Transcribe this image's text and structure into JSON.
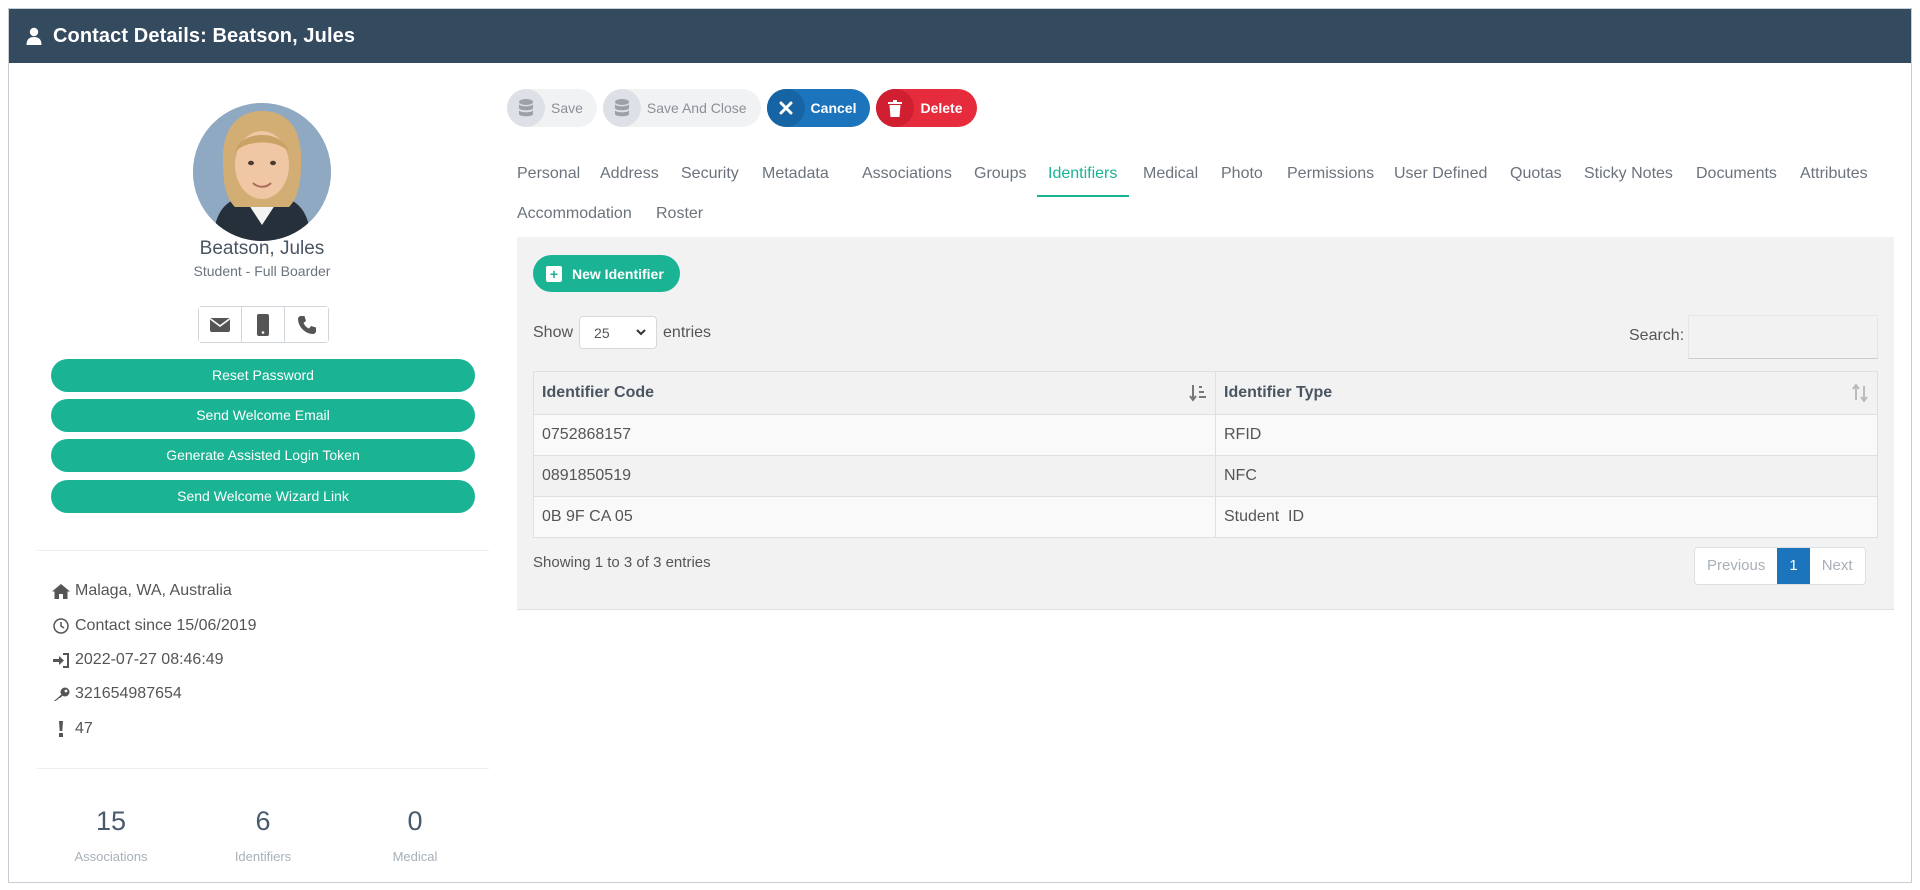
{
  "window": {
    "title": "Contact Details: Beatson, Jules"
  },
  "profile": {
    "name": "Beatson, Jules",
    "role": "Student - Full Boarder",
    "contact_icons": [
      "envelope-icon",
      "mobile-icon",
      "phone-icon"
    ],
    "actions": [
      "Reset Password",
      "Send Welcome Email",
      "Generate Assisted Login Token",
      "Send Welcome Wizard Link"
    ],
    "info": [
      {
        "icon": "home-icon",
        "text": "Malaga, WA, Australia"
      },
      {
        "icon": "clock-icon",
        "text": "Contact since 15/06/2019"
      },
      {
        "icon": "sign-in-icon",
        "text": "2022-07-27 08:46:49"
      },
      {
        "icon": "key-icon",
        "text": "321654987654"
      },
      {
        "icon": "exclamation-icon",
        "text": "47"
      }
    ],
    "stats": [
      {
        "value": "15",
        "label": "Associations"
      },
      {
        "value": "6",
        "label": "Identifiers"
      },
      {
        "value": "0",
        "label": "Medical"
      }
    ]
  },
  "toolbar": {
    "save": "Save",
    "save_close": "Save And Close",
    "cancel": "Cancel",
    "delete": "Delete"
  },
  "tabs": [
    "Personal",
    "Address",
    "Security",
    "Metadata",
    "Associations",
    "Groups",
    "Identifiers",
    "Medical",
    "Photo",
    "Permissions",
    "User Defined",
    "Quotas",
    "Sticky Notes",
    "Documents",
    "Attributes",
    "Accommodation",
    "Roster"
  ],
  "active_tab": "Identifiers",
  "identifiers": {
    "new_button": "New Identifier",
    "show_label": "Show",
    "entries_value": "25",
    "entries_label": "entries",
    "search_label": "Search:",
    "columns": [
      "Identifier Code",
      "Identifier Type"
    ],
    "rows": [
      [
        "0752868157",
        "RFID"
      ],
      [
        "0891850519",
        "NFC"
      ],
      [
        "0B 9F CA 05",
        "Student  ID"
      ]
    ],
    "summary": "Showing 1 to 3 of 3 entries",
    "pager": {
      "prev": "Previous",
      "current": "1",
      "next": "Next"
    }
  },
  "colors": {
    "header": "#344a5f",
    "accent_green": "#1ab394",
    "cancel_blue": "#1c75bc",
    "delete_red": "#e52b3c"
  }
}
